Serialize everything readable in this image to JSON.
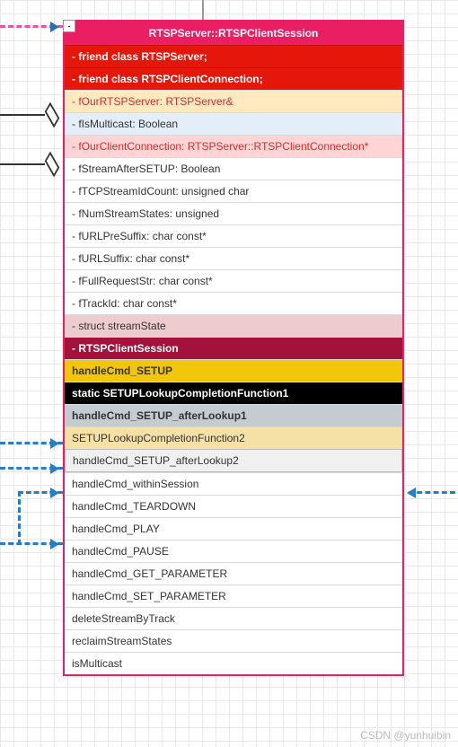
{
  "header": {
    "title": "RTSPServer::RTSPClientSession",
    "collapse": "-"
  },
  "rows": [
    {
      "text": "- friend class RTSPServer;",
      "cls": "r-red",
      "name": "friend-rtspserver"
    },
    {
      "text": "- friend class RTSPClientConnection;",
      "cls": "r-red",
      "name": "friend-rtspclientconnection"
    },
    {
      "text": "- fOurRTSPServer: RTSPServer&",
      "cls": "r-cream",
      "name": "field-fourrtspserver"
    },
    {
      "text": "- fIsMulticast: Boolean",
      "cls": "r-blue",
      "name": "field-fismulticast"
    },
    {
      "text": "- fOurClientConnection: RTSPServer::RTSPClientConnection*",
      "cls": "r-pink",
      "name": "field-fourclientconnection"
    },
    {
      "text": "- fStreamAfterSETUP: Boolean",
      "cls": "r-plain",
      "name": "field-fstreamaftersetup"
    },
    {
      "text": "- fTCPStreamIdCount: unsigned char",
      "cls": "r-plain",
      "name": "field-ftcpstreamidcount"
    },
    {
      "text": "- fNumStreamStates: unsigned",
      "cls": "r-plain",
      "name": "field-fnumstreamstates"
    },
    {
      "text": "- fURLPreSuffix: char const*",
      "cls": "r-plain",
      "name": "field-furlpresuffix"
    },
    {
      "text": "- fURLSuffix: char const*",
      "cls": "r-plain",
      "name": "field-furlsuffix"
    },
    {
      "text": "- fFullRequestStr: char const*",
      "cls": "r-plain",
      "name": "field-ffullrequeststr"
    },
    {
      "text": "- fTrackId: char const*",
      "cls": "r-plain",
      "name": "field-ftrackid"
    },
    {
      "text": "- struct streamState",
      "cls": "r-rose",
      "name": "struct-streamstate"
    },
    {
      "text": "- RTSPClientSession",
      "cls": "r-maroon",
      "name": "rtspclientsession"
    },
    {
      "text": "handleCmd_SETUP",
      "cls": "r-gold",
      "name": "method-handlecmd-setup"
    },
    {
      "text": "static  SETUPLookupCompletionFunction1",
      "cls": "r-black",
      "name": "method-setuplookupcompletionfunction1"
    },
    {
      "text": "handleCmd_SETUP_afterLookup1",
      "cls": "r-gray",
      "name": "method-handlecmd-setup-afterlookup1"
    },
    {
      "text": "SETUPLookupCompletionFunction2",
      "cls": "r-lcream",
      "name": "method-setuplookupcompletionfunction2"
    },
    {
      "text": "handleCmd_SETUP_afterLookup2",
      "cls": "r-lgray",
      "name": "method-handlecmd-setup-afterlookup2"
    },
    {
      "text": "handleCmd_withinSession",
      "cls": "r-plain",
      "name": "method-handlecmd-withinsession"
    },
    {
      "text": "handleCmd_TEARDOWN",
      "cls": "r-plain",
      "name": "method-handlecmd-teardown"
    },
    {
      "text": "handleCmd_PLAY",
      "cls": "r-plain",
      "name": "method-handlecmd-play"
    },
    {
      "text": "handleCmd_PAUSE",
      "cls": "r-plain",
      "name": "method-handlecmd-pause"
    },
    {
      "text": "handleCmd_GET_PARAMETER",
      "cls": "r-plain",
      "name": "method-handlecmd-get-parameter"
    },
    {
      "text": "handleCmd_SET_PARAMETER",
      "cls": "r-plain",
      "name": "method-handlecmd-set-parameter"
    },
    {
      "text": "deleteStreamByTrack",
      "cls": "r-plain",
      "name": "method-deletestreambytrack"
    },
    {
      "text": "reclaimStreamStates",
      "cls": "r-plain",
      "name": "method-reclaimstreamstates"
    },
    {
      "text": "isMulticast",
      "cls": "r-plain",
      "name": "method-ismulticast"
    }
  ],
  "watermark": "CSDN @yunhuibin"
}
